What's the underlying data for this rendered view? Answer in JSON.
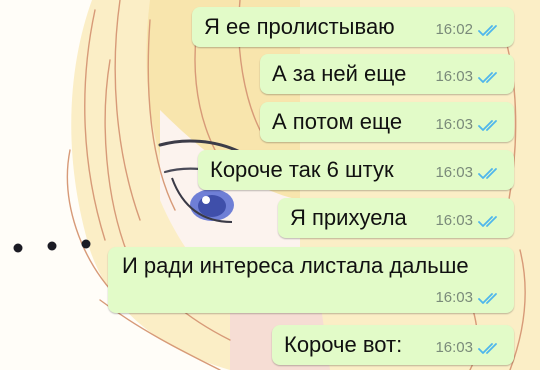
{
  "chat": {
    "messages": [
      {
        "text": "Я ее пролистываю",
        "time": "16:02",
        "status_icon": "double-check-read-icon"
      },
      {
        "text": "А за ней еще",
        "time": "16:03",
        "status_icon": "double-check-read-icon"
      },
      {
        "text": "А потом еще",
        "time": "16:03",
        "status_icon": "double-check-read-icon"
      },
      {
        "text": "Короче так 6 штук",
        "time": "16:03",
        "status_icon": "double-check-read-icon"
      },
      {
        "text": "Я прихуела",
        "time": "16:03",
        "status_icon": "double-check-read-icon"
      },
      {
        "text": "И ради интереса листала дальше",
        "time": "16:03",
        "status_icon": "double-check-read-icon"
      },
      {
        "text": "Короче вот:",
        "time": "16:03",
        "status_icon": "double-check-read-icon"
      }
    ]
  },
  "annotation": {
    "text": "..."
  },
  "colors": {
    "outgoing_bubble": "#e2fbc8",
    "read_check": "#4fb6ec",
    "time_text": "#7a8a7a",
    "hair": "#f7e3a6",
    "hair_outline": "#d89a7a"
  }
}
